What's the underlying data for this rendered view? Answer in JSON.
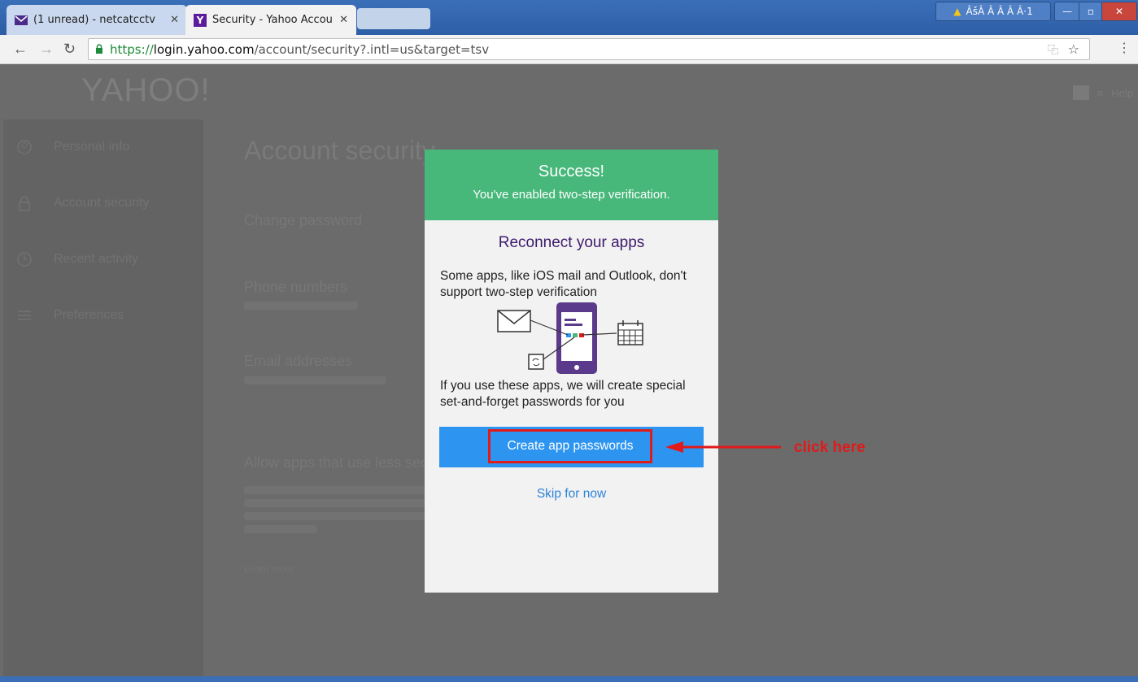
{
  "browser": {
    "tabs": [
      {
        "title": "(1 unread) - netcatcctv",
        "icon": "mail-icon"
      },
      {
        "title": "Security - Yahoo Accou",
        "icon": "yahoo-icon"
      }
    ],
    "window_label": "ÂšÂ Â Â Â Â·1",
    "url_scheme": "https://",
    "url_host": "login.yahoo.com",
    "url_path": "/account/security?.intl=us&target=tsv"
  },
  "page": {
    "logo": "YAHOO!",
    "sidebar": [
      {
        "label": "Personal info",
        "icon": "person-icon"
      },
      {
        "label": "Account security",
        "icon": "lock-icon"
      },
      {
        "label": "Recent activity",
        "icon": "clock-icon"
      },
      {
        "label": "Preferences",
        "icon": "list-icon"
      }
    ],
    "help_label": "Help",
    "title": "Account security",
    "change_password": "Change password",
    "phone_numbers": "Phone numbers",
    "email_addresses": "Email addresses",
    "allow_apps": "Allow apps that use less secure sign in",
    "learn_more": "Learn more"
  },
  "modal": {
    "success": "Success!",
    "enabled": "You've enabled two-step verification.",
    "title": "Reconnect your apps",
    "text1": "Some apps, like iOS mail and Outlook, don't support two-step verification",
    "text2": "If you use these apps, we will create special set-and-forget passwords for you",
    "button": "Create app passwords",
    "skip": "Skip for now"
  },
  "annotation": {
    "text": "click here",
    "color": "#e11a1a"
  },
  "colors": {
    "success_green": "#47b77a",
    "button_blue": "#2d95f0",
    "title_purple": "#3d1a6e",
    "link_blue": "#2d83d8"
  }
}
